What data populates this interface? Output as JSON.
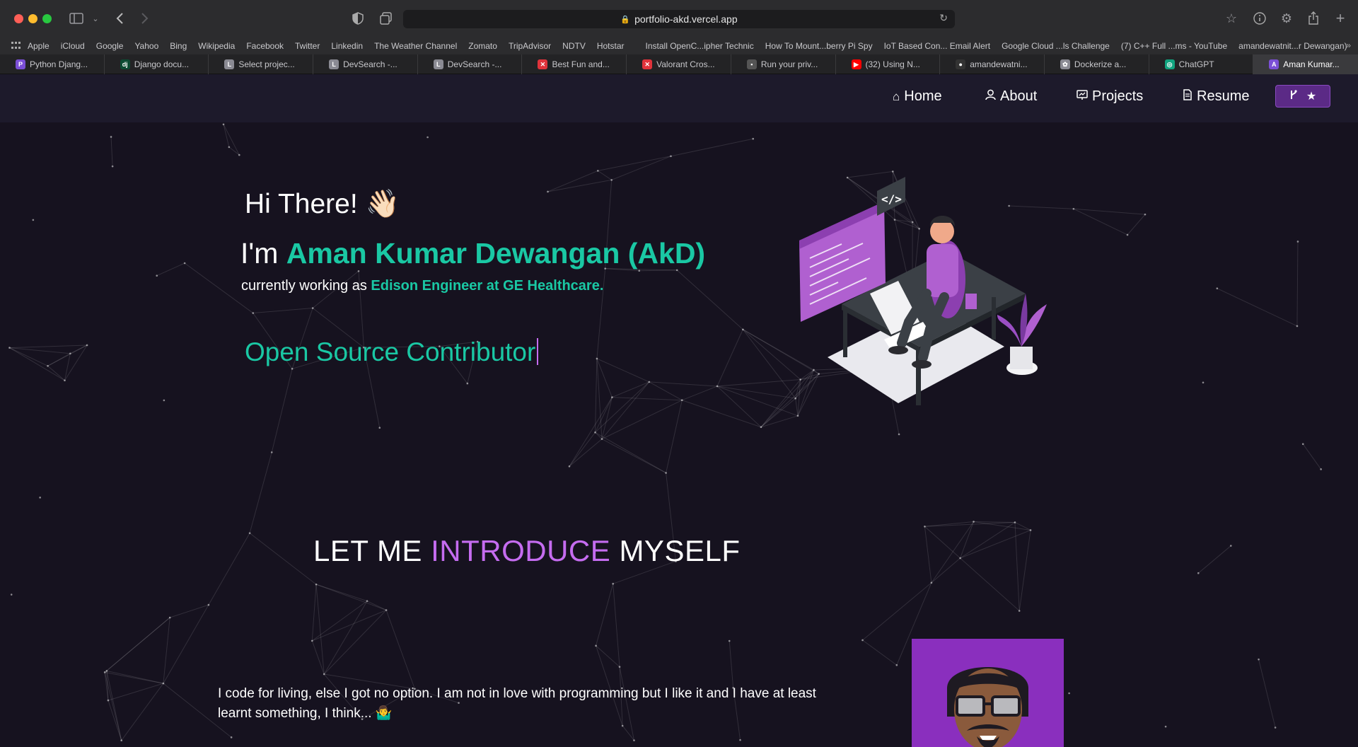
{
  "browser": {
    "url": "portfolio-akd.vercel.app",
    "bookmarks": [
      "Apple",
      "iCloud",
      "Google",
      "Yahoo",
      "Bing",
      "Wikipedia",
      "Facebook",
      "Twitter",
      "Linkedin",
      "The Weather Channel",
      "Zomato",
      "TripAdvisor",
      "NDTV",
      "Hotstar",
      "Install OpenC...ipher Technic",
      "How To Mount...berry Pi Spy",
      "IoT Based Con... Email Alert",
      "Google Cloud ...ls Challenge",
      "(7) C++ Full ...ms - YouTube",
      "amandewatnit...r Dewangan)"
    ],
    "tabs": [
      {
        "label": "Python Djang...",
        "color": "#7b4fd6",
        "glyph": "P"
      },
      {
        "label": "Django docu...",
        "color": "#0c4b33",
        "glyph": "dj"
      },
      {
        "label": "Select projec...",
        "color": "#8a8a93",
        "glyph": "L"
      },
      {
        "label": "DevSearch -...",
        "color": "#8a8a93",
        "glyph": "L"
      },
      {
        "label": "DevSearch -...",
        "color": "#8a8a93",
        "glyph": "L"
      },
      {
        "label": "Best Fun and...",
        "color": "#e0333b",
        "glyph": "✕"
      },
      {
        "label": "Valorant Cros...",
        "color": "#e0333b",
        "glyph": "✕"
      },
      {
        "label": "Run your priv...",
        "color": "#555",
        "glyph": "▪"
      },
      {
        "label": "(32) Using N...",
        "color": "#ff0000",
        "glyph": "▶"
      },
      {
        "label": "amandewatni...",
        "color": "#333",
        "glyph": "●"
      },
      {
        "label": "Dockerize a...",
        "color": "#8a8a93",
        "glyph": "✿"
      },
      {
        "label": "ChatGPT",
        "color": "#10a37f",
        "glyph": "◎"
      },
      {
        "label": "Aman Kumar...",
        "color": "#7b4fd6",
        "glyph": "A"
      }
    ]
  },
  "nav": {
    "home": "Home",
    "about": "About",
    "projects": "Projects",
    "resume": "Resume"
  },
  "hero": {
    "greeting": "Hi There! 👋🏻",
    "im_prefix": "I'm ",
    "name": "Aman Kumar Dewangan (AkD)",
    "working_prefix": "currently working as ",
    "role": "Edison Engineer at GE Healthcare.",
    "typed": "Open Source Contributor"
  },
  "intro": {
    "heading_1": "LET ME ",
    "heading_highlight": "INTRODUCE",
    "heading_2": " MYSELF",
    "text": "I code for living, else I got no option. I am not in love with programming but I like it and I have at least learnt something, I think... 🤷‍♂️"
  },
  "colors": {
    "accent_green": "#1ac8a4",
    "accent_purple": "#c56cf0",
    "background": "#16121f"
  }
}
